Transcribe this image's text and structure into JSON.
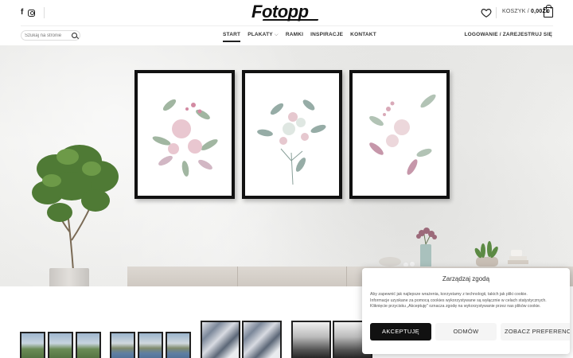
{
  "header": {
    "logo": "Fotopp",
    "cart_label": "KOSZYK /",
    "cart_amount": "0,00ZŁ",
    "cart_count": "0",
    "social": {
      "facebook": "f"
    }
  },
  "search": {
    "placeholder": "Szukaj na stronie"
  },
  "nav": {
    "items": [
      {
        "label": "START"
      },
      {
        "label": "PLAKATY"
      },
      {
        "label": "RAMKI"
      },
      {
        "label": "INSPIRACJE"
      },
      {
        "label": "KONTAKT"
      }
    ],
    "plakaty_chevron": "⌵",
    "login": "LOGOWANIE / ZAREJESTRUJ SIĘ"
  },
  "cookie": {
    "title": "Zarządzaj zgodą",
    "line1": "Aby zapewnić jak najlepsze wrażenia, korzystamy z technologii, takich jak pliki cookie.",
    "line2": "Informacje uzyskane za pomocą cookies wykorzystywane są wyłącznie w celach statystycznych.",
    "line3": "Kliknięcie przycisku „Akceptuję\" oznacza zgodę na wykorzystywanie przez nas plików cookie.",
    "accept": "AKCEPTUJĘ",
    "deny": "ODMÓW",
    "prefs": "ZOBACZ PREFERENCJE"
  },
  "colors": {
    "accent": "#111111",
    "hero_wall": "#ecece9",
    "frame": "#111111"
  },
  "icons": [
    "facebook-icon",
    "instagram-icon",
    "heart-icon",
    "cart-icon",
    "search-icon",
    "chevron-down-icon"
  ]
}
